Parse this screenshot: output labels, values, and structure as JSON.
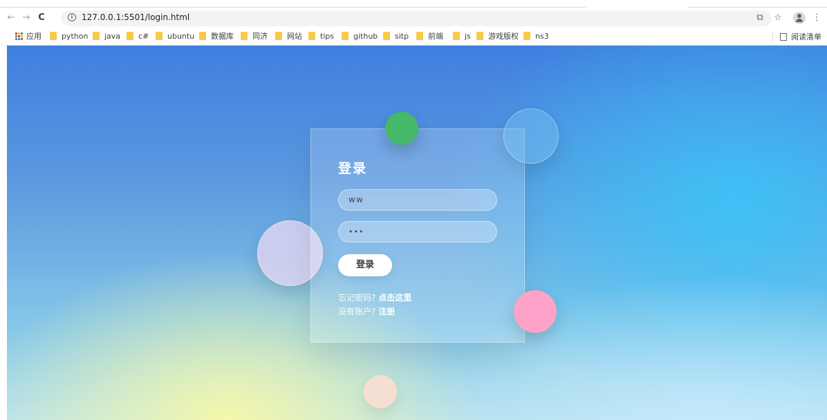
{
  "browser": {
    "url": "127.0.0.1:5501/login.html",
    "bookmarks": [
      {
        "label": "应用",
        "kind": "apps"
      },
      {
        "label": "python",
        "kind": "folder"
      },
      {
        "label": "java",
        "kind": "folder"
      },
      {
        "label": "c#",
        "kind": "folder"
      },
      {
        "label": "ubuntu",
        "kind": "folder"
      },
      {
        "label": "数据库",
        "kind": "folder"
      },
      {
        "label": "同济",
        "kind": "folder"
      },
      {
        "label": "网站",
        "kind": "folder"
      },
      {
        "label": "tips",
        "kind": "folder"
      },
      {
        "label": "github",
        "kind": "folder"
      },
      {
        "label": "sitp",
        "kind": "folder"
      },
      {
        "label": "前端",
        "kind": "folder"
      },
      {
        "label": "js",
        "kind": "folder"
      },
      {
        "label": "游戏版权",
        "kind": "folder"
      },
      {
        "label": "ns3",
        "kind": "folder"
      }
    ],
    "reading_list": "阅读清单",
    "icons": {
      "back": "←",
      "forward": "→",
      "reload": "C",
      "info": "i",
      "share": "⧉",
      "star": "☆",
      "menu": "⋮"
    },
    "folder_color": "#f8c94b"
  },
  "login": {
    "title": "登录",
    "username_value": "ww",
    "password_mask": "•••",
    "submit_label": "登录",
    "forgot_prompt": "忘记密码?",
    "forgot_link": "点击这里",
    "signup_prompt": "没有账户?",
    "signup_link": "注册"
  },
  "colors": {
    "bubble_green": "#45b86a",
    "bubble_pink": "#fda2c9",
    "card_text": "#ffffff"
  }
}
